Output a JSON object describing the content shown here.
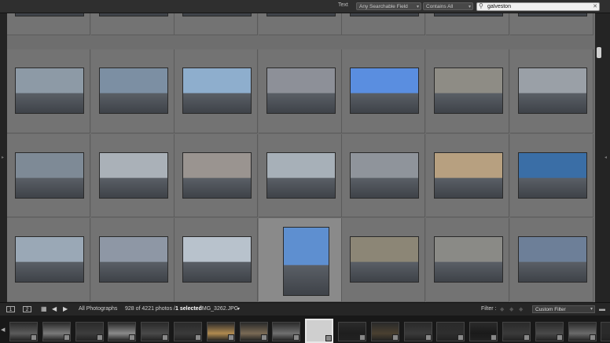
{
  "filter_bar": {
    "text_label": "Text",
    "field_selector": "Any Searchable Field",
    "match_selector": "Contains All",
    "search_value": "galveston",
    "search_placeholder": "Search"
  },
  "grid": {
    "rows": [
      [
        "#a8a69a",
        "#8e97ad",
        "#6b5d3d",
        "#5d88ad",
        "#8a8274",
        "#6c6a62",
        "#3f6fa8"
      ],
      [
        "#8d9aa6",
        "#7c8fa3",
        "#8eaecd",
        "#8d9098",
        "#5a8ee0",
        "#8e8c85",
        "#9aa0a7"
      ],
      [
        "#7e8a96",
        "#aab1b8",
        "#9a9490",
        "#a7b0b8",
        "#8f949b",
        "#b7a080",
        "#3a6ea6"
      ],
      [
        "#9aa8b6",
        "#8e97a5",
        "#b8c2cc",
        "#5e8fd0",
        "#8c8676",
        "#8a8a86",
        "#6d7f98"
      ]
    ],
    "selected": {
      "row": 3,
      "col": 3
    }
  },
  "bottom_bar": {
    "view_btn_1": "1",
    "view_btn_2": "2",
    "source": "All Photographs",
    "count": "928 of 4221 photos /",
    "selected_label": "1 selected",
    "filename": "/IMG_3262.JPG",
    "filter_label": "Filter :",
    "filter_preset": "Custom Filter"
  },
  "filmstrip": {
    "thumbs": [
      "#5c5c5c",
      "#7a7a7a",
      "#3d3d3d",
      "#8a8a8a",
      "#4a4a4a",
      "#3a3a3a",
      "#b08a50",
      "#7a6a55",
      "#707070",
      "#cccccc",
      "#1e1e1e",
      "#4a4030",
      "#3a3a3a",
      "#2e2e2e",
      "#1a1a1a",
      "#3a3a3a",
      "#4a4a4a",
      "#6a6a6a",
      "#2a2a2a"
    ],
    "selected_index": 9
  },
  "colors": {
    "accent": "#e8e8e8",
    "grid_bg": "#6e6e6e"
  }
}
